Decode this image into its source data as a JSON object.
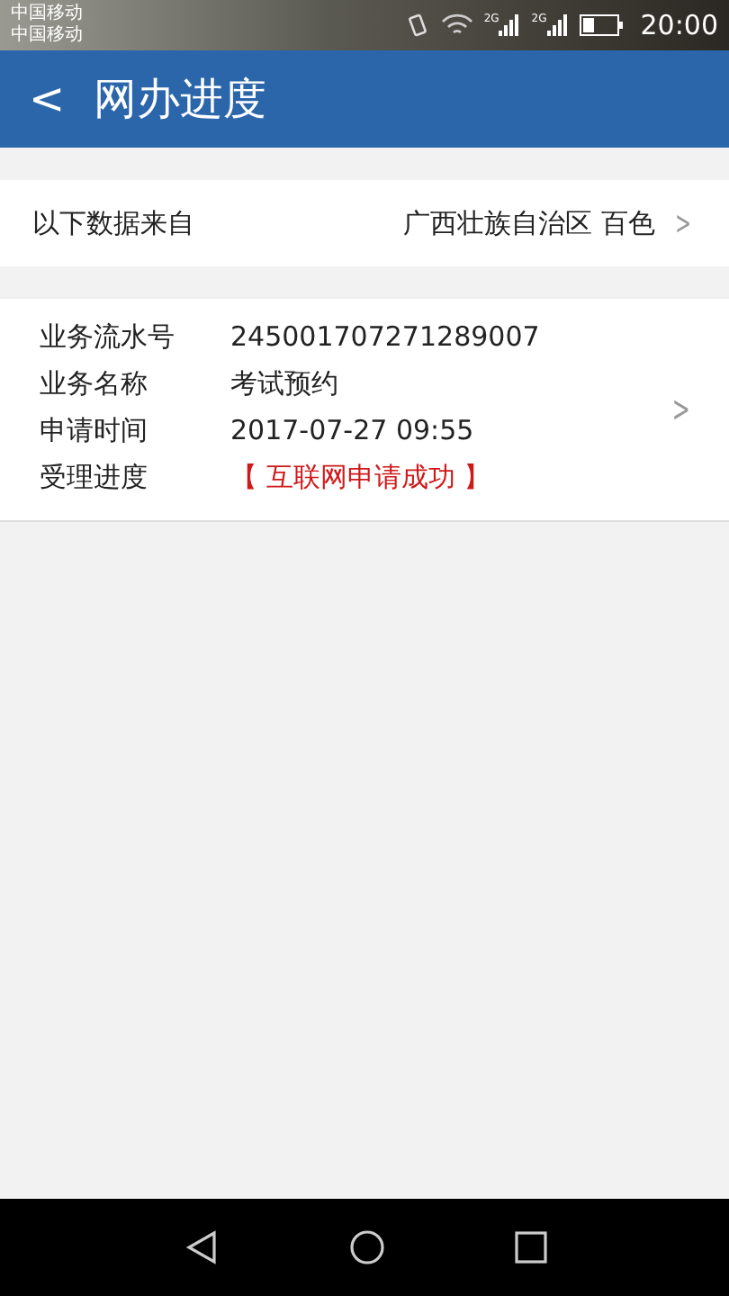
{
  "status_bar": {
    "carriers": [
      "中国移动",
      "中国移动"
    ],
    "network_labels": [
      "2G",
      "2G"
    ],
    "time": "20:00"
  },
  "header": {
    "back": "<",
    "title": "网办进度"
  },
  "source": {
    "label": "以下数据来自",
    "value": "广西壮族自治区 百色",
    "chevron": ">"
  },
  "record": {
    "chevron": ">",
    "fields": [
      {
        "label": "业务流水号",
        "value": "245001707271289007",
        "kind": "text"
      },
      {
        "label": "业务名称",
        "value": "考试预约",
        "kind": "text"
      },
      {
        "label": "申请时间",
        "value": "2017-07-27 09:55",
        "kind": "text"
      },
      {
        "label": "受理进度",
        "value": "【 互联网申请成功 】",
        "kind": "status"
      }
    ]
  }
}
